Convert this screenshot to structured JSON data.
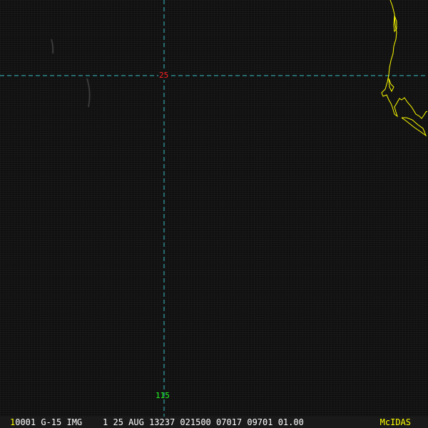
{
  "image": {
    "latitude_label": "25",
    "longitude_label": "115",
    "crosshair_color": "#40e0e8",
    "coastline_color": "#ffff00"
  },
  "status_bar": {
    "frame_number": "1",
    "info": "0001 G-15 IMG    1 25 AUG 13237 021500 07017 09701 01.00",
    "brand": "McIDAS"
  }
}
